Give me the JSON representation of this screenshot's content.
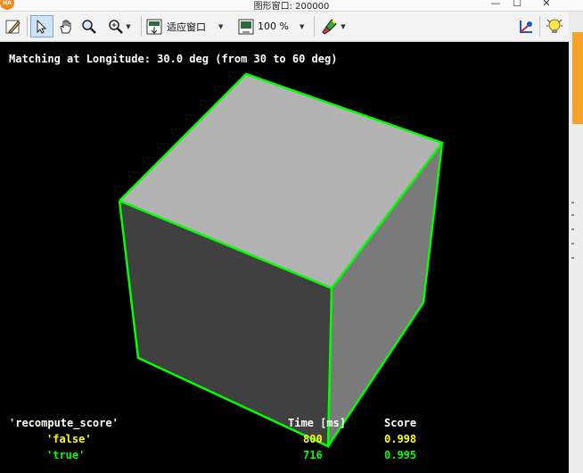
{
  "window": {
    "logo_text": "HA",
    "title": "图形窗口: 200000",
    "min_glyph": "—",
    "max_glyph": "☐",
    "close_glyph": "✕"
  },
  "toolbar": {
    "fit_label": "适应窗口",
    "zoom_label": "100 %"
  },
  "overlay": {
    "heading": "Matching at Longitude: 30.0 deg (from 30 to 60 deg)",
    "table": {
      "col_param": "'recompute_score'",
      "col_time": "Time [ms]",
      "col_score": "Score",
      "rows": [
        {
          "param": "'false'",
          "time": "800",
          "score": "0.998",
          "color": "#ffff00"
        },
        {
          "param": "'true'",
          "time": "716",
          "score": "0.995",
          "color": "#00ff00"
        }
      ]
    }
  },
  "colors": {
    "edge": "#00ff00",
    "top_face": "#b3b3b3",
    "front_face": "#404040",
    "right_face": "#7a7a7a",
    "background": "#000000"
  }
}
